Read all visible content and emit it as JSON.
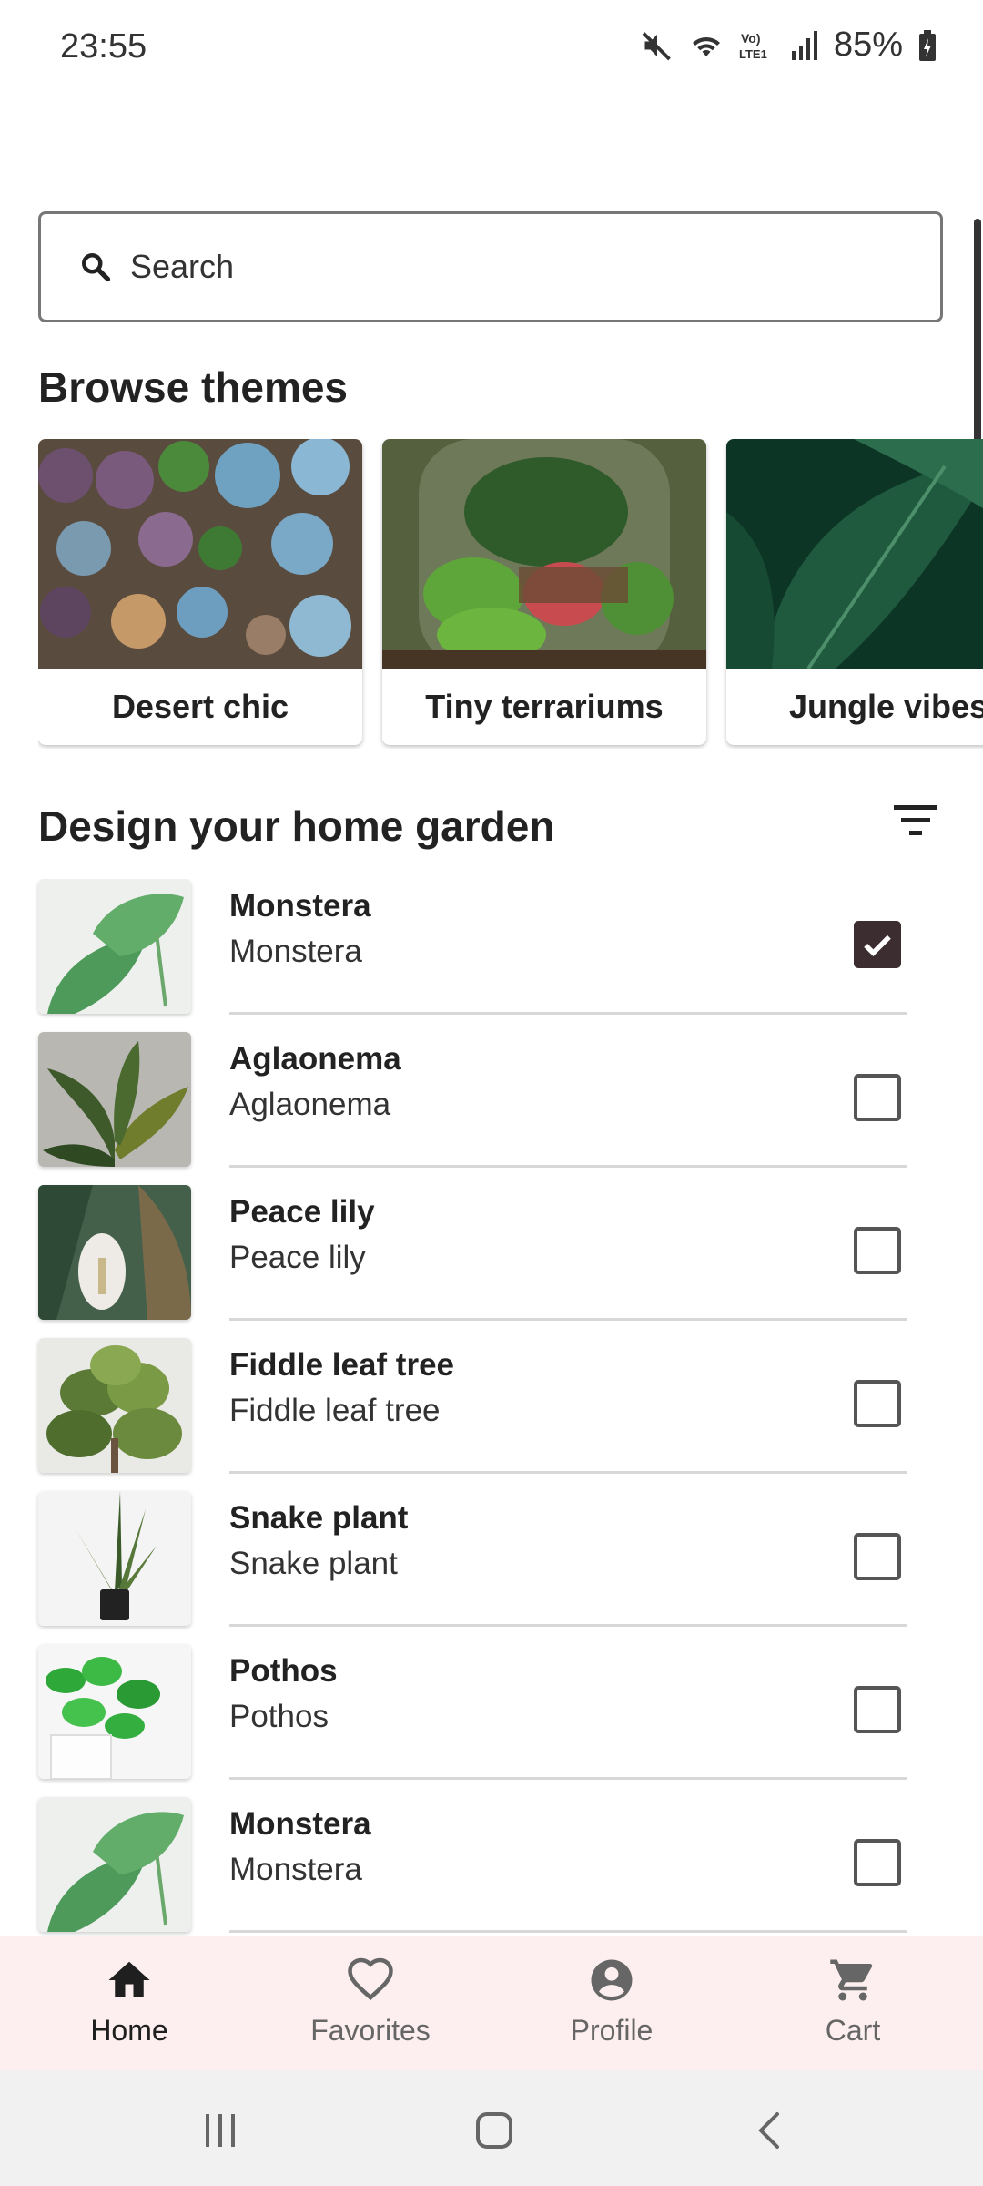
{
  "status_bar": {
    "time": "23:55",
    "battery": "85%",
    "icons": [
      "mute-icon",
      "wifi-icon",
      "volte-icon",
      "signal-icon",
      "battery-icon"
    ]
  },
  "search": {
    "placeholder": "Search",
    "value": ""
  },
  "browse": {
    "title": "Browse themes",
    "themes": [
      {
        "label": "Desert chic"
      },
      {
        "label": "Tiny terrariums"
      },
      {
        "label": "Jungle vibes"
      }
    ]
  },
  "garden": {
    "title": "Design your home garden",
    "filter_icon": "filter-list-icon",
    "plants": [
      {
        "name": "Monstera",
        "subtitle": "Monstera",
        "checked": true
      },
      {
        "name": "Aglaonema",
        "subtitle": "Aglaonema",
        "checked": false
      },
      {
        "name": "Peace lily",
        "subtitle": "Peace lily",
        "checked": false
      },
      {
        "name": "Fiddle leaf tree",
        "subtitle": "Fiddle leaf tree",
        "checked": false
      },
      {
        "name": "Snake plant",
        "subtitle": "Snake plant",
        "checked": false
      },
      {
        "name": "Pothos",
        "subtitle": "Pothos",
        "checked": false
      },
      {
        "name": "Monstera",
        "subtitle": "Monstera",
        "checked": false
      }
    ]
  },
  "bottom_nav": {
    "items": [
      {
        "label": "Home",
        "icon": "home-icon",
        "active": true
      },
      {
        "label": "Favorites",
        "icon": "heart-icon",
        "active": false
      },
      {
        "label": "Profile",
        "icon": "account-circle-icon",
        "active": false
      },
      {
        "label": "Cart",
        "icon": "cart-icon",
        "active": false
      }
    ]
  },
  "colors": {
    "checked_box": "#3c2e30",
    "nav_background": "#fdefef",
    "nav_active": "#1f1f1f",
    "nav_inactive": "#666666"
  }
}
